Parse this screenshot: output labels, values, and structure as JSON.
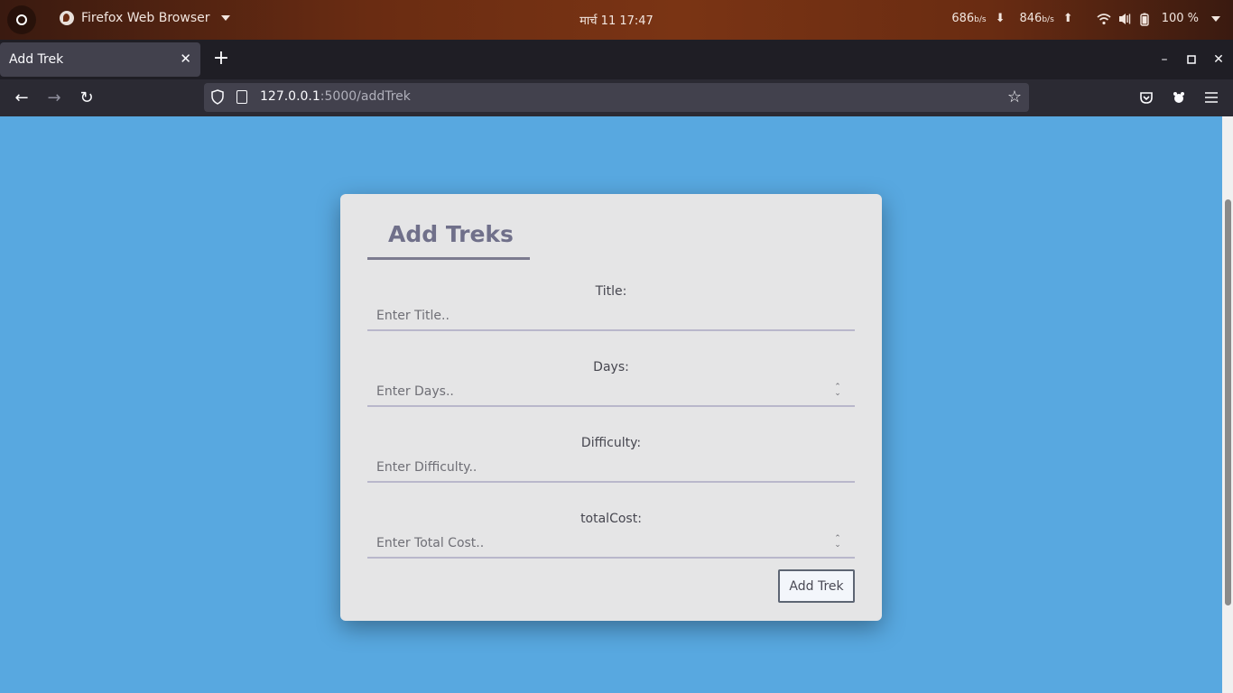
{
  "system_bar": {
    "app_name": "Firefox Web Browser",
    "datetime": "मार्च 11  17:47",
    "net_down_value": "686",
    "net_down_unit": "b/s",
    "net_up_value": "846",
    "net_up_unit": "b/s",
    "battery": "100 %"
  },
  "browser": {
    "tab_title": "Add Trek",
    "url_host": "127.0.0.1",
    "url_rest": ":5000/addTrek"
  },
  "form": {
    "heading": "Add Treks",
    "fields": [
      {
        "label": "Title:",
        "placeholder": "Enter Title.."
      },
      {
        "label": "Days:",
        "placeholder": "Enter Days.."
      },
      {
        "label": "Difficulty:",
        "placeholder": "Enter Difficulty.."
      },
      {
        "label": "totalCost:",
        "placeholder": "Enter Total Cost.."
      }
    ],
    "submit_label": "Add Trek"
  }
}
